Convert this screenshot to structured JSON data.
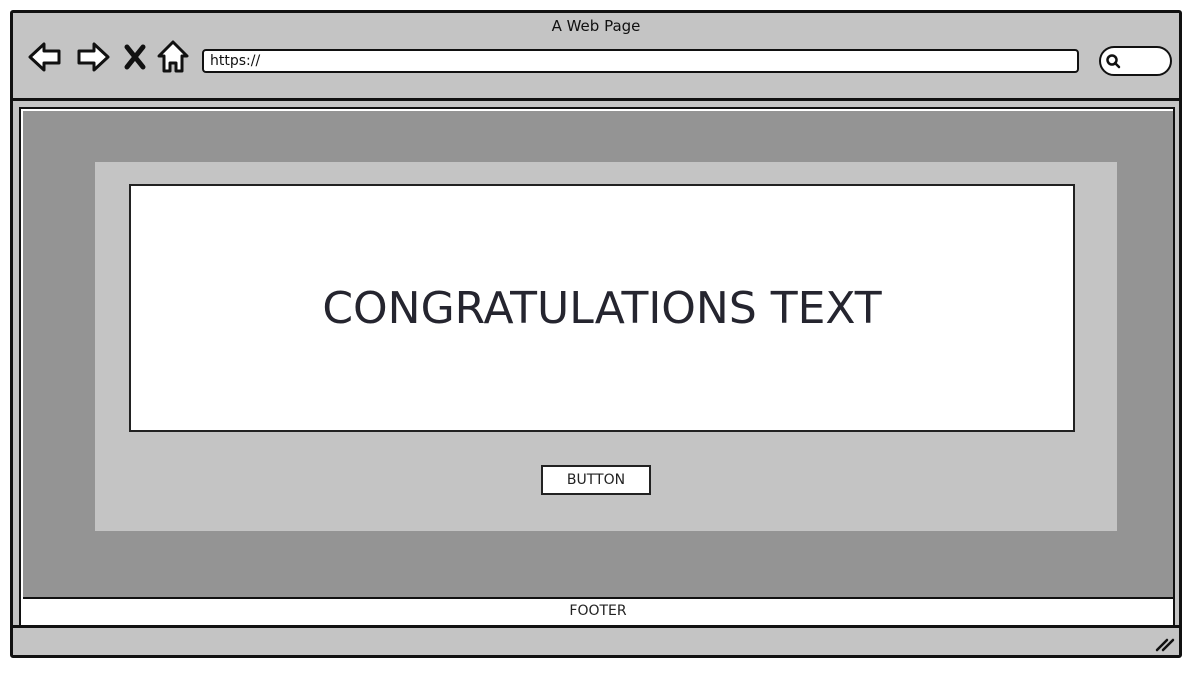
{
  "window": {
    "title": "A Web Page"
  },
  "toolbar": {
    "back_icon": "back-arrow-icon",
    "forward_icon": "forward-arrow-icon",
    "stop_icon": "close-icon",
    "home_icon": "home-icon",
    "url_value": "https://",
    "search_icon": "search-icon"
  },
  "main": {
    "message": "CONGRATULATIONS TEXT",
    "button_label": "BUTTON"
  },
  "footer": {
    "label": "FOOTER"
  },
  "colors": {
    "chrome": "#c4c4c4",
    "canvas": "#949494",
    "panel": "#c4c4c4",
    "text": "#25252f"
  }
}
